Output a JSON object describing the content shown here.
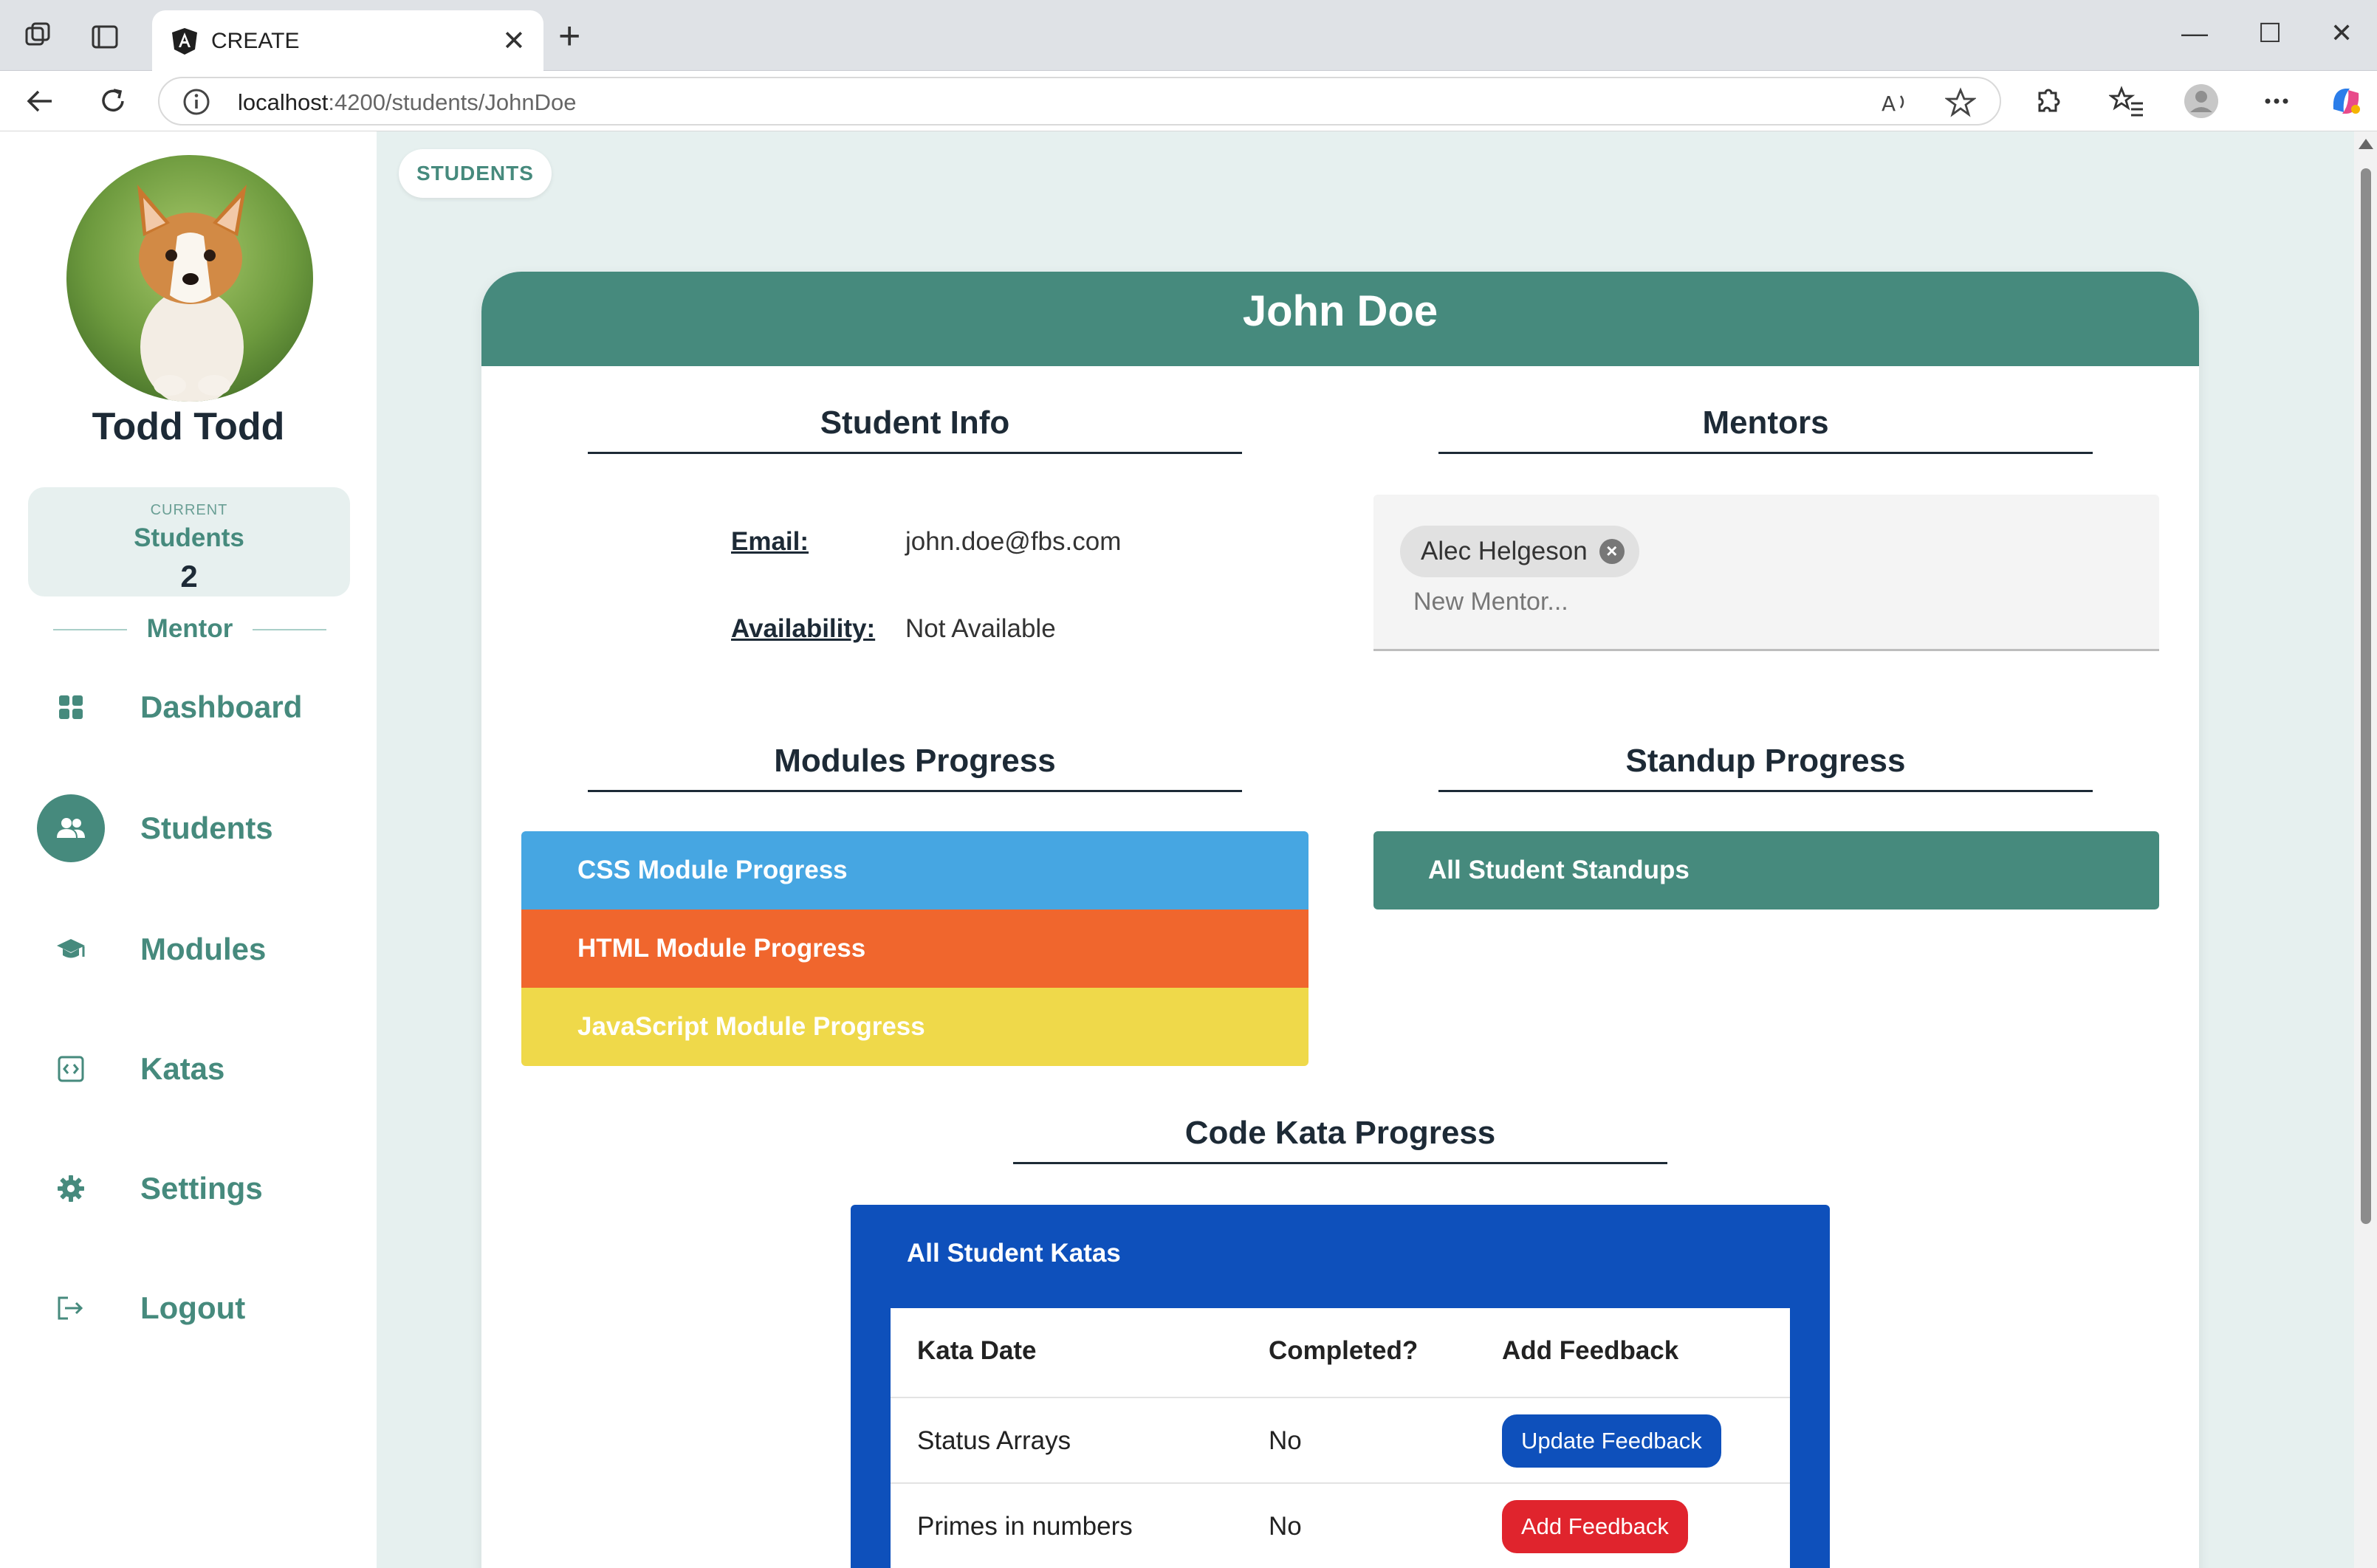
{
  "browser": {
    "tab_title": "CREATE",
    "url_host": "localhost",
    "url_rest": ":4200/students/JohnDoe"
  },
  "sidebar": {
    "user_name": "Todd Todd",
    "current_label": "CURRENT",
    "current_value": "Students",
    "current_count": "2",
    "role": "Mentor",
    "nav": [
      {
        "label": "Dashboard",
        "icon": "grid-icon"
      },
      {
        "label": "Students",
        "icon": "users-icon"
      },
      {
        "label": "Modules",
        "icon": "graduation-cap-icon"
      },
      {
        "label": "Katas",
        "icon": "code-icon"
      },
      {
        "label": "Settings",
        "icon": "gear-icon"
      },
      {
        "label": "Logout",
        "icon": "logout-icon"
      }
    ],
    "active_index": 1
  },
  "main": {
    "breadcrumb": "STUDENTS",
    "student_name": "John Doe",
    "student_info": {
      "title": "Student Info",
      "email_label": "Email:",
      "email_value": "john.doe@fbs.com",
      "availability_label": "Availability:",
      "availability_value": "Not Available"
    },
    "mentors": {
      "title": "Mentors",
      "chips": [
        "Alec Helgeson"
      ],
      "input_placeholder": "New Mentor..."
    },
    "modules": {
      "title": "Modules Progress",
      "items": [
        {
          "label": "CSS Module Progress",
          "color": "#46a6e2"
        },
        {
          "label": "HTML Module Progress",
          "color": "#f0662d"
        },
        {
          "label": "JavaScript Module Progress",
          "color": "#efd94a"
        }
      ]
    },
    "standup": {
      "title": "Standup Progress",
      "button": "All Student Standups"
    },
    "katas": {
      "title": "Code Kata Progress",
      "panel_title": "All Student Katas",
      "columns": [
        "Kata Date",
        "Completed?",
        "Add Feedback"
      ],
      "rows": [
        {
          "name": "Status Arrays",
          "completed": "No",
          "action": "Update Feedback",
          "action_color": "#0e50bb"
        },
        {
          "name": "Primes in numbers",
          "completed": "No",
          "action": "Add Feedback",
          "action_color": "#e0242d"
        }
      ]
    }
  },
  "colors": {
    "primary": "#468a7d",
    "main_bg": "#e6f0ef",
    "kata_blue": "#0e50bb"
  }
}
